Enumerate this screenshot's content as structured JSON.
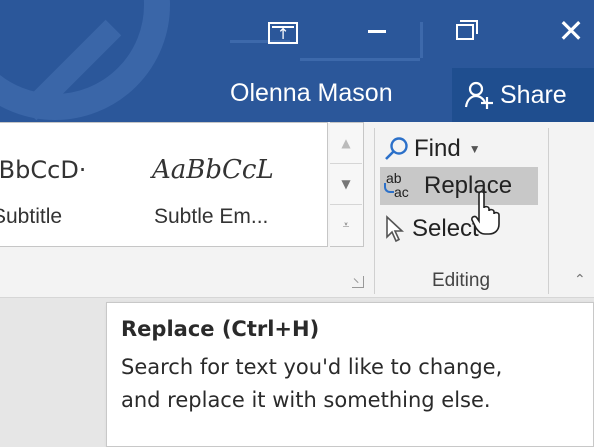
{
  "window": {
    "controls": {
      "ribbon_display_glyph": "↑",
      "minimize_icon": "minimize-icon",
      "restore_icon": "restore-icon",
      "close_glyph": "✕"
    },
    "user_name": "Olenna Mason",
    "share_label": "Share",
    "titlebar_color": "#2b579a"
  },
  "ribbon": {
    "styles_gallery": {
      "items": [
        {
          "sample": "ıBbCcD·",
          "name": "Subtitle"
        },
        {
          "sample": "AaBbCcL",
          "name": "Subtle Em..."
        }
      ]
    },
    "editing": {
      "find_label": "Find",
      "replace_label": "Replace",
      "select_label": "Select",
      "group_label": "Editing"
    }
  },
  "tooltip": {
    "title": "Replace (Ctrl+H)",
    "body": "Search for text you'd like to change, and replace it with something else."
  }
}
